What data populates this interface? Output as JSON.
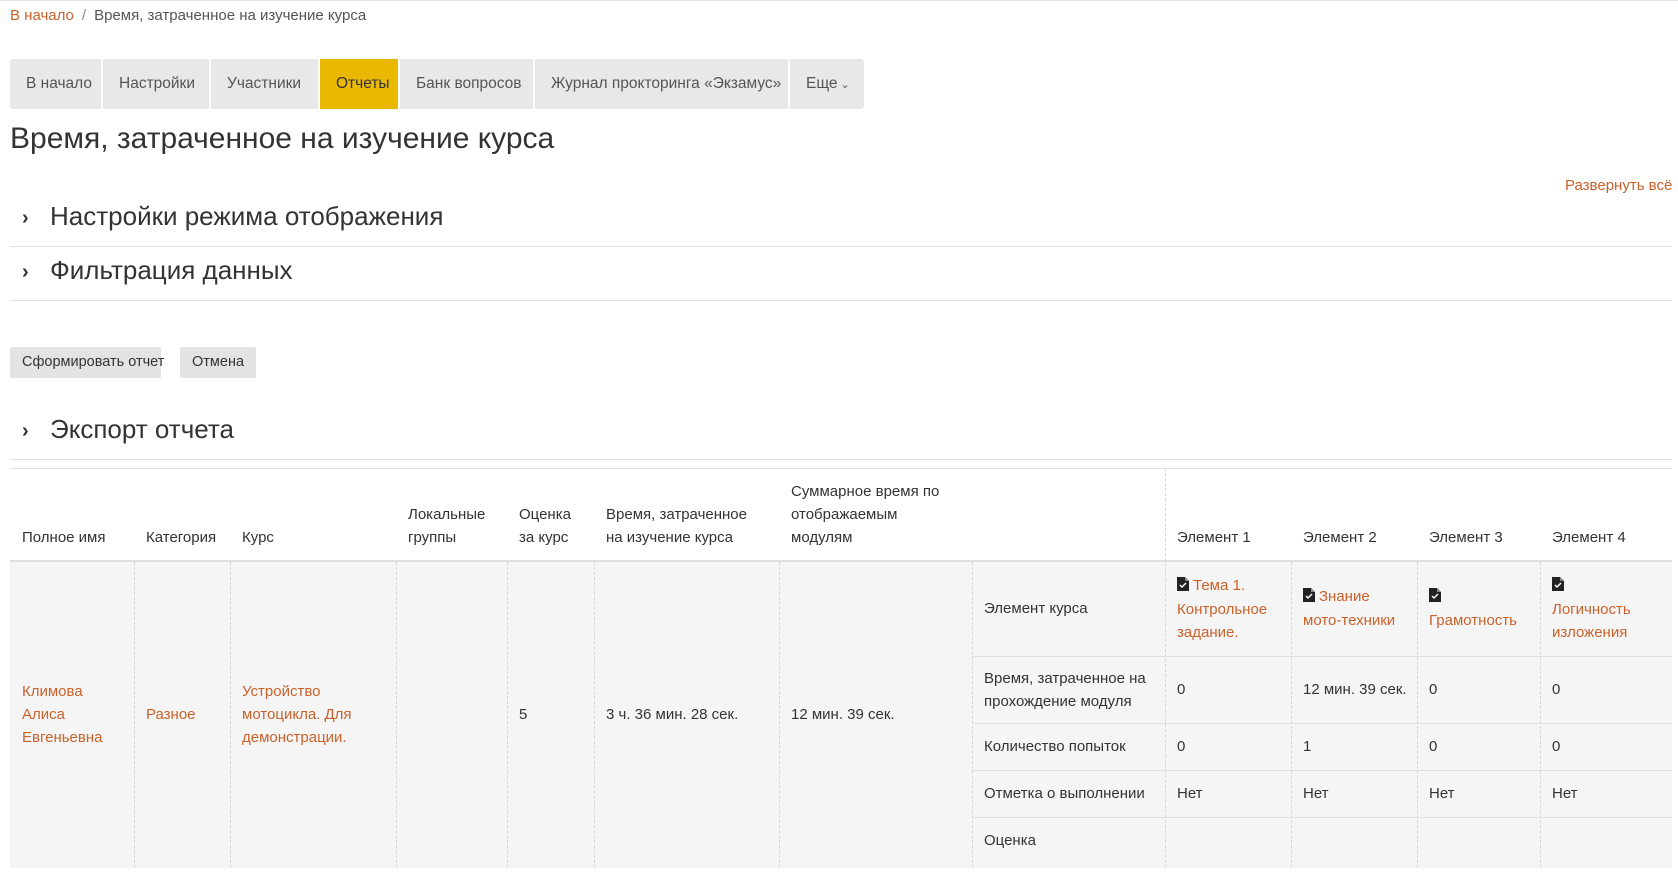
{
  "breadcrumb": {
    "home": "В начало",
    "separator": "/",
    "current": "Время, затраченное на изучение курса"
  },
  "tabs": [
    {
      "label": "В начало",
      "active": false
    },
    {
      "label": "Настройки",
      "active": false
    },
    {
      "label": "Участники",
      "active": false
    },
    {
      "label": "Отчеты",
      "active": true
    },
    {
      "label": "Банк вопросов",
      "active": false
    },
    {
      "label": "Журнал прокторинга «Экзамус»",
      "active": false
    },
    {
      "label": "Еще",
      "active": false,
      "icon": "chevron-down-icon"
    }
  ],
  "page_title": "Время, затраченное на изучение курса",
  "expand_all": "Развернуть всё",
  "sections": {
    "display_settings": "Настройки режима отображения",
    "data_filter": "Фильтрация данных",
    "export": "Экспорт отчета"
  },
  "buttons": {
    "run": "Сформировать отчет",
    "cancel": "Отмена"
  },
  "table": {
    "headers": {
      "fullname": "Полное имя",
      "category": "Категория",
      "course": "Курс",
      "groups_1": "Локальные",
      "groups_2": "группы",
      "grade_1": "Оценка",
      "grade_2": "за курс",
      "time_1": "Время, затраченное",
      "time_2": "на изучение курса",
      "sum_1": "Суммарное время по",
      "sum_2": "отображаемым",
      "sum_3": "модулям",
      "elements": [
        "Элемент 1",
        "Элемент 2",
        "Элемент 3",
        "Элемент 4"
      ]
    },
    "row": {
      "name_1": "Климова",
      "name_2": "Алиса",
      "name_3": "Евгеньевна",
      "category": "Разное",
      "course_1": "Устройство",
      "course_2": "мотоцикла. Для",
      "course_3": "демонстрации.",
      "groups": "",
      "grade": "5",
      "time": "3 ч. 36 мин. 28 сек.",
      "sum": "12 мин. 39 сек."
    },
    "subrows": {
      "element": "Элемент курса",
      "time_1": "Время, затраченное на",
      "time_2": "прохождение модуля",
      "attempts": "Количество попыток",
      "completion": "Отметка о выполнении",
      "grade": "Оценка"
    },
    "modules": [
      {
        "lines": [
          "Тема 1.",
          "Контрольное",
          "задание."
        ],
        "time": "0",
        "attempts": "0",
        "completion": "Нет",
        "grade": ""
      },
      {
        "lines": [
          "Знание",
          "мото-техники"
        ],
        "time": "12 мин. 39 сек.",
        "attempts": "1",
        "completion": "Нет",
        "grade": ""
      },
      {
        "lines": [
          "Грамотность"
        ],
        "time": "0",
        "attempts": "0",
        "completion": "Нет",
        "grade": ""
      },
      {
        "lines": [
          "Логичность",
          "изложения"
        ],
        "time": "0",
        "attempts": "0",
        "completion": "Нет",
        "grade": ""
      }
    ],
    "module_icon": "assignment-icon"
  },
  "colors": {
    "accent": "#eab800",
    "link": "#c9622b",
    "tab_bg": "#e8e8e8",
    "row_bg": "#f5f5f5"
  }
}
